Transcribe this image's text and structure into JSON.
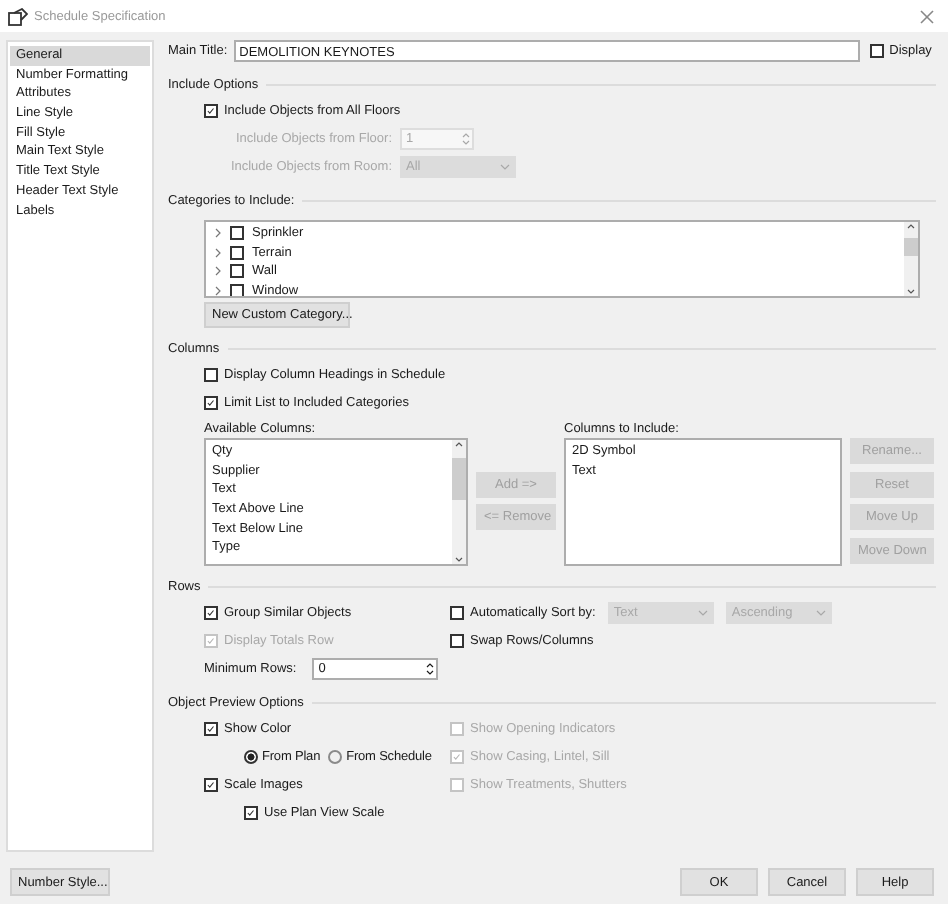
{
  "window": {
    "title": "Schedule Specification"
  },
  "sidebar": {
    "items": [
      {
        "label": "General",
        "selected": true
      },
      {
        "label": "Number Formatting",
        "selected": false
      },
      {
        "label": "Attributes",
        "selected": false
      },
      {
        "label": "Line Style",
        "selected": false
      },
      {
        "label": "Fill Style",
        "selected": false
      },
      {
        "label": "Main Text Style",
        "selected": false
      },
      {
        "label": "Title Text Style",
        "selected": false
      },
      {
        "label": "Header Text Style",
        "selected": false
      },
      {
        "label": "Labels",
        "selected": false
      }
    ]
  },
  "main_title": {
    "label": "Main Title:",
    "value": "DEMOLITION KEYNOTES",
    "display": {
      "label": "Display",
      "checked": false
    }
  },
  "include_options": {
    "title": "Include Options",
    "all_floors": {
      "label": "Include Objects from All Floors",
      "checked": true
    },
    "floor": {
      "label": "Include Objects from Floor:",
      "value": "1",
      "disabled": true
    },
    "room": {
      "label": "Include Objects from Room:",
      "value": "All",
      "disabled": true
    }
  },
  "categories": {
    "title": "Categories to Include:",
    "items": [
      {
        "label": "Sprinkler",
        "checked": false,
        "expanded": false
      },
      {
        "label": "Terrain",
        "checked": false,
        "expanded": false
      },
      {
        "label": "Wall",
        "checked": false,
        "expanded": false
      },
      {
        "label": "Window",
        "checked": false,
        "expanded": false
      }
    ],
    "button": "New Custom Category..."
  },
  "columns": {
    "title": "Columns",
    "options": [
      {
        "label": "Display Column Headings in Schedule",
        "checked": false
      },
      {
        "label": "Limit List to Included Categories",
        "checked": true
      }
    ],
    "available_label": "Available Columns:",
    "available": [
      "Qty",
      "Supplier",
      "Text",
      "Text Above Line",
      "Text Below Line",
      "Type"
    ],
    "include_label": "Columns to Include:",
    "include": [
      "2D Symbol",
      "Text"
    ],
    "transfer_buttons": [
      {
        "label": "Add =>",
        "disabled": true
      },
      {
        "label": "<= Remove",
        "disabled": true
      }
    ],
    "side_buttons": [
      {
        "label": "Rename...",
        "disabled": true
      },
      {
        "label": "Reset",
        "disabled": true
      },
      {
        "label": "Move Up",
        "disabled": true
      },
      {
        "label": "Move Down",
        "disabled": true
      }
    ]
  },
  "rows": {
    "title": "Rows",
    "group": {
      "label": "Group Similar Objects",
      "checked": true,
      "disabled": false
    },
    "totals": {
      "label": "Display Totals Row",
      "checked": true,
      "disabled": true
    },
    "minimum_rows": {
      "label": "Minimum Rows:",
      "value": "0"
    },
    "auto_sort": {
      "label": "Automatically Sort by:",
      "checked": false,
      "disabled": false
    },
    "sort_field": {
      "value": "Text",
      "disabled": true
    },
    "sort_order": {
      "value": "Ascending",
      "disabled": true
    },
    "swap": {
      "label": "Swap Rows/Columns",
      "checked": false,
      "disabled": false
    }
  },
  "preview": {
    "title": "Object Preview Options",
    "show_color": {
      "label": "Show Color",
      "checked": true,
      "disabled": false
    },
    "color_source": [
      {
        "label": "From Plan",
        "selected": true
      },
      {
        "label": "From Schedule",
        "selected": false
      }
    ],
    "scale_images": {
      "label": "Scale Images",
      "checked": true,
      "disabled": false
    },
    "plan_view_scale": {
      "label": "Use Plan View Scale",
      "checked": true,
      "disabled": false
    },
    "right": [
      {
        "label": "Show Opening Indicators",
        "checked": false,
        "disabled": true
      },
      {
        "label": "Show Casing, Lintel, Sill",
        "checked": true,
        "disabled": true
      },
      {
        "label": "Show Treatments, Shutters",
        "checked": false,
        "disabled": true
      }
    ]
  },
  "footer": {
    "left_button": "Number Style...",
    "buttons": [
      "OK",
      "Cancel",
      "Help"
    ]
  }
}
